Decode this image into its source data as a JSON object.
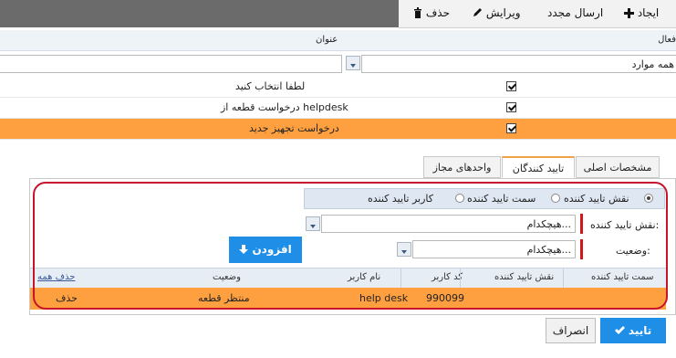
{
  "toolbar": {
    "create_label": "ایجاد",
    "resend_label": "ارسال مجدد",
    "edit_label": "ویرایش",
    "delete_label": "حذف"
  },
  "grid": {
    "col_active": "فعال",
    "col_title": "عنوان",
    "filter_value": "همه موارد",
    "rows": [
      {
        "title": "لطفا انتخاب کنید",
        "checked": true
      },
      {
        "title": "درخواست قطعه از helpdesk",
        "checked": true
      },
      {
        "title": "درخواست تجهیز جدید",
        "checked": true,
        "selected": true
      }
    ]
  },
  "tabs": {
    "main": "مشخصات اصلی",
    "approvers": "تایید کنندگان",
    "units": "واحدهای مجاز"
  },
  "approvers": {
    "radio_role": "نقش تایید کننده",
    "radio_position": "سمت تایید کننده",
    "radio_user": "کاربر تایید کننده",
    "role_label": "نقش تایید کننده:",
    "role_value": "هیچکدام...",
    "status_label": "وضعیت:",
    "status_value": "هیچکدام...",
    "add_label": "افزودن"
  },
  "table": {
    "headers": {
      "position": "سمت تایید کننده",
      "role": "نقش تایید کننده",
      "user_code": "کد کاربر",
      "user_name": "نام کاربر",
      "status": "وضعیت",
      "delete_all": "حذف همه"
    },
    "rows": [
      {
        "position": "",
        "role": "",
        "user_code": "990099",
        "user_name": "help desk",
        "status": "منتظر قطعه",
        "delete": "حذف"
      }
    ]
  },
  "footer": {
    "ok_label": "تایید",
    "cancel_label": "انصراف"
  },
  "colors": {
    "accent": "#1f8ee6",
    "selected_row": "#ffa040",
    "highlight": "#c7142a"
  }
}
